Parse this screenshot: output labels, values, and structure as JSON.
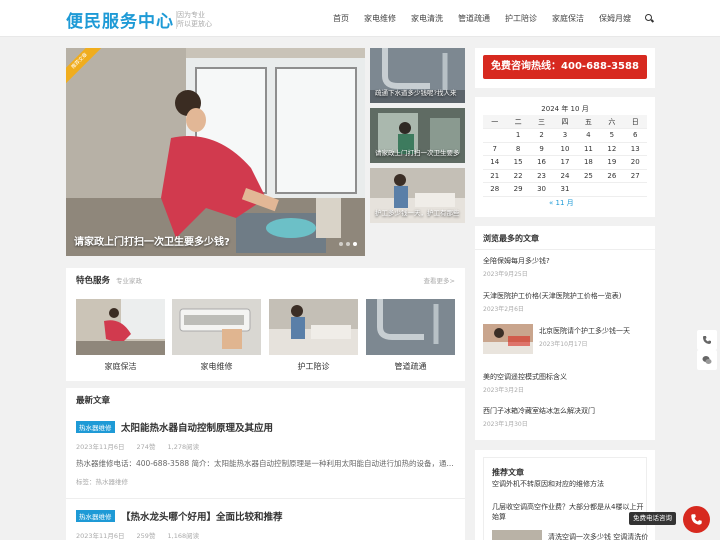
{
  "header": {
    "logo": "便民服务中心",
    "slogan_line1": "因为专业",
    "slogan_line2": "所以更放心",
    "nav": [
      "首页",
      "家电维修",
      "家电清洗",
      "管道疏通",
      "护工陪诊",
      "家庭保洁",
      "保姆月嫂"
    ]
  },
  "slider": {
    "ribbon": "推荐文章",
    "caption": "请家政上门打扫一次卫生要多少钱?",
    "thumbs": [
      "疏通下水道多少钱呢?找人来",
      "请家政上门打扫一次卫生要多",
      "护工多少钱一天，护工有那些"
    ]
  },
  "features": {
    "title": "特色服务",
    "subtitle": "专业家政",
    "more": "查看更多>",
    "items": [
      "家庭保洁",
      "家电维修",
      "护工陪诊",
      "管道疏通"
    ]
  },
  "articles": {
    "title": "最新文章",
    "list": [
      {
        "tag": "热水器维修",
        "title": "太阳能热水器自动控制原理及其应用",
        "date": "2023年11月6日",
        "likes": "274赞",
        "views": "1,278阅读",
        "excerpt": "热水器维修电话：400-688-3588 简介：太阳能热水器自动控制原理是一种利用太阳能自动进行加热的设备，通...",
        "tags": "标签：热水器维修"
      },
      {
        "tag": "热水器维修",
        "title": "【热水龙头哪个好用】全面比较和推荐",
        "date": "2023年11月6日",
        "likes": "259赞",
        "views": "1,168阅读"
      }
    ]
  },
  "sidebar": {
    "hotline": "免费咨询热线：400-688-3588",
    "calendar": {
      "caption": "2024 年 10 月",
      "weekdays": [
        "一",
        "二",
        "三",
        "四",
        "五",
        "六",
        "日"
      ],
      "rows": [
        [
          "",
          "1",
          "2",
          "3",
          "4",
          "5",
          "6"
        ],
        [
          "7",
          "8",
          "9",
          "10",
          "11",
          "12",
          "13"
        ],
        [
          "14",
          "15",
          "16",
          "17",
          "18",
          "19",
          "20"
        ],
        [
          "21",
          "22",
          "23",
          "24",
          "25",
          "26",
          "27"
        ],
        [
          "28",
          "29",
          "30",
          "31",
          "",
          "",
          ""
        ]
      ],
      "prev": "« 11 月"
    },
    "popular": {
      "title": "浏览最多的文章",
      "items": [
        {
          "t": "全陪保姆每月多少钱?",
          "d": "2023年9月25日"
        },
        {
          "t": "天津医院护工价格(天津医院护工价格一览表)",
          "d": "2023年2月6日"
        },
        {
          "t": "北京医院请个护工多少钱一天",
          "d": "2023年10月17日"
        },
        {
          "t": "美的空调遥控模式图标含义",
          "d": "2023年3月2日"
        },
        {
          "t": "西门子冰箱冷藏室结冰怎么解决双门",
          "d": "2023年1月30日"
        }
      ]
    },
    "recommend": {
      "title": "推荐文章",
      "items": [
        "空调外机不转原因和对应的维修方法",
        "几层收空调高空作业费？大部分都是从4楼以上开始算",
        "清洗空调一次多少钱 空调清洗价目"
      ]
    }
  },
  "float": {
    "call_label": "免费电话咨询"
  }
}
